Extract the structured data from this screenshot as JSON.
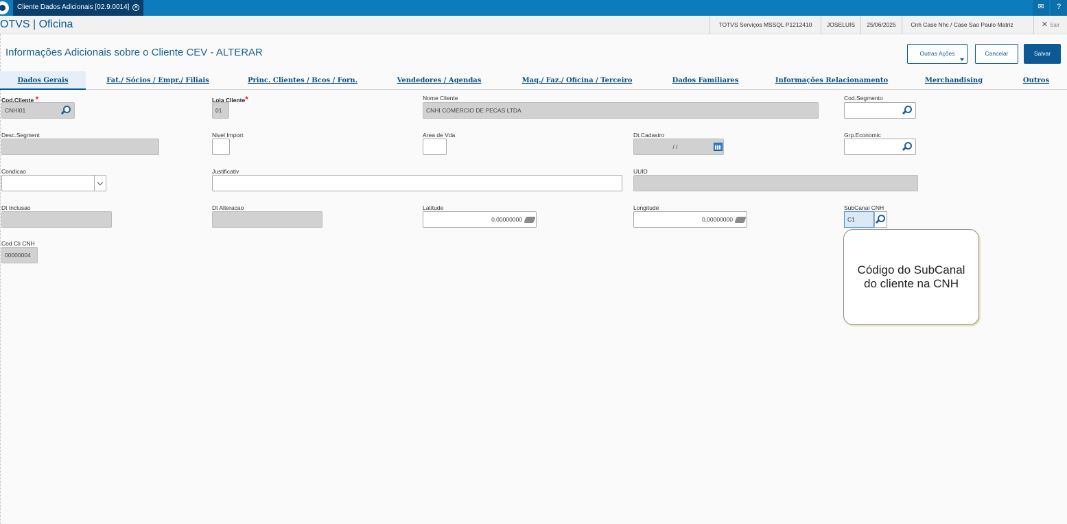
{
  "window": {
    "tab_title": "Cliente Dados Adicionais [02.9.0014]",
    "tab_close": "✕",
    "mail_icon": "mail-icon",
    "help_icon": "help-icon"
  },
  "header": {
    "app_title": "OTVS | Oficina",
    "environment": "TOTVS Serviços MSSQL P1212410",
    "user": "JOSELUIS",
    "date": "25/06/2025",
    "branch": "Cnh Case Nhc / Case Sao Paulo Matriz",
    "exit_label": "Sair",
    "exit_icon": "✕"
  },
  "page": {
    "title": "Informações Adicionais sobre o Cliente CEV - ALTERAR",
    "buttons": {
      "other_actions": "Outras Ações",
      "cancel": "Cancelar",
      "save": "Salvar"
    }
  },
  "tabs": [
    {
      "label": "Dados Gerais",
      "active": true
    },
    {
      "label": "Fat./ Sócios / Empr./ Filiais"
    },
    {
      "label": "Princ. Clientes / Bcos / Forn."
    },
    {
      "label": "Vendedores / Agendas"
    },
    {
      "label": "Maq./ Faz./ Oficina / Terceiro"
    },
    {
      "label": "Dados Familiares"
    },
    {
      "label": "Informações Relacionamento"
    },
    {
      "label": "Merchandising"
    },
    {
      "label": "Outros"
    }
  ],
  "form": {
    "cod_cliente": {
      "label": "Cod.Cliente",
      "value": "CNHI01",
      "required": "*"
    },
    "loja_cliente": {
      "label": "Loja Cliente",
      "value": "01",
      "required": "*"
    },
    "nome_cliente": {
      "label": "Nome Cliente",
      "value": "CNHI COMERCIO DE PECAS LTDA"
    },
    "cod_segmento": {
      "label": "Cod.Segmento",
      "value": ""
    },
    "desc_segment": {
      "label": "Desc.Segment",
      "value": ""
    },
    "nivel_import": {
      "label": "Nivel Import",
      "value": ""
    },
    "area_vda": {
      "label": "Area de Vda",
      "value": ""
    },
    "dt_cadastro": {
      "label": "Dt.Cadastro",
      "value": "/ /"
    },
    "grp_economic": {
      "label": "Grp.Economic",
      "value": ""
    },
    "condicao": {
      "label": "Condicao",
      "value": ""
    },
    "justificativ": {
      "label": "Justificativ",
      "value": ""
    },
    "uuid": {
      "label": "UUID",
      "value": ""
    },
    "dt_inclusao": {
      "label": "Dt Inclusao",
      "value": ""
    },
    "dt_alteracao": {
      "label": "Dt Alteracao",
      "value": ""
    },
    "latitude": {
      "label": "Latitude",
      "value": "0,00000000"
    },
    "longitude": {
      "label": "Longitude",
      "value": "0,00000000"
    },
    "subcanal_cnh": {
      "label": "SubCanal CNH",
      "value": "C1"
    },
    "cod_cli_cnh": {
      "label": "Cod Cli CNH",
      "value": "00000004"
    }
  },
  "tooltip": {
    "text": "Código do SubCanal do cliente na CNH"
  }
}
